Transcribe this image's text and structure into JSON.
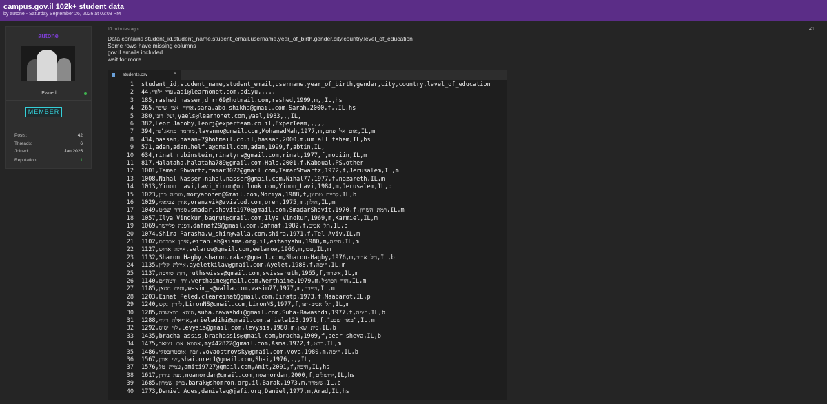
{
  "thread": {
    "title": "campus.gov.il 102k+ student data",
    "byline": "by autone - Saturday September 26, 2026 at 02:03 PM"
  },
  "author": {
    "username": "autone",
    "rank": "Pwned",
    "badge": "MEMBER",
    "stats": [
      {
        "label": "Posts:",
        "value": "42"
      },
      {
        "label": "Threads:",
        "value": "6"
      },
      {
        "label": "Joined:",
        "value": "Jan 2025"
      },
      {
        "label": "Reputation:",
        "value": "1"
      }
    ]
  },
  "post": {
    "time": "17 minutes ago",
    "number": "#1",
    "lines": [
      "Data contains student_id,student_name,student_email,username,year_of_birth,gender,city,country,level_of_education",
      "Some rows have missing columns",
      "gov.il emails included",
      "wait for more"
    ]
  },
  "editor": {
    "tab_label": "students.csv",
    "close_glyph": "×",
    "lines": [
      "student_id,student_name,student_email,username,year_of_birth,gender,city,country,level_of_education",
      "44,עדי ילודי,adi@learnonet.com,adiyu,,,,,",
      "185,rashed nasser,d_rn69@hotmail.com,rashed,1999,m,,IL,hs",
      "265,ארוח אבו שיכה,sara.abo.shikha@gmail.com,Sarah,2000,f,,IL,hs",
      "380,יעל רונן,yaels@learnonet.com,yael,1983,,,IL,",
      "382,Leor Jacoby,leorj@experteam.co.il,ExperTeam,,,,,",
      "394,מוחמד מחאג'נה,layanmo@gmail.com,MohamedMah,1977,m,אום אל פחם,IL,m",
      "434,hassan,hasan-7@hotmail.co.il,hassan,2000,m,um all fahem,IL,hs",
      "571,adan,adan.helf.a@gmail.com,adan,1999,f,abtin,IL,",
      "634,rinat rubinstein,rinatyrs@gmail.com,rinat,1977,f,modiin,IL,m",
      "817,Halataha,halataha789@gmail.com,Hala,2001,f,Kaboual,PS,other",
      "1001,Tamar Shwartz,tamar3022@gmail.com,TamarShwartz,1972,f,Jerusalem,IL,m",
      "1008,Nihal Nasser,nihal.nasser@gmail.com,Nihal77,1977,f,nazareth,IL,m",
      "1013,Yinon Lavi,Lavi_Yinon@outlook.com,Yinon_Lavi,1984,m,Jerusalem,IL,b",
      "1023,מוריה כהן,moryacohen@Gmail.com,Moriya,1988,f,קריית טבעון,IL,b",
      "1029,אורן צביאלי,orenzvik@zvialod.com,oren,1975,m,חולון,IL,m",
      "1049,סמדר שביט,smadar.shavit1970@gmail.com,SmadarShavit,1970,f,רמת השרון,IL,m",
      "1057,Ilya Vinokur,bagrut@gmail.com,Ilya_Vinokur,1969,m,Karmiel,IL,m",
      "1069,דפנה פליישר,dafnaf29@gmail.com,Dafnaf,1982,f,תל אביב,IL,b",
      "1074,Shira Parasha,w_shir@walla.com,shira,1971,f,Tel Aviv,IL,m",
      "1102,איתן אברהם,eitan.ab@sisma.org.il,eitanyahu,1980,m,חיפה,IL,m",
      "1127,אילה ארוש,eelarow@gmail.com,eelarow,1966,m,עכו,IL,m",
      "1132,Sharon Hagby,sharon.rakaz@gmail.com,Sharon-Hagby,1976,m,תל אביב,IL,b",
      "1135,איילת קליין,ayeletkilav@gmail.com,Ayelet,1988,f,חיפה,IL,m",
      "1137,רות סוויסה,ruthswissa@gmail.com,swissaruth,1965,f,אשדוד,IL,m",
      "1140,ורד ורטהיים,werthaime@gmail.com,Werthaime,1979,m,חוף הכרמל,IL,m",
      "1185,וסים חסאן,wasim_s@walla.com,wasim77,1977,m,טייבה,IL,m",
      "1203,Einat Peled,cleareinat@gmail.com,Einatp,1973,f,Maabarot,IL,p",
      "1240,לירון נקש,LironNS@gmail.com,LironNS,1977,f,תל אביב-יפו,IL,m",
      "1285,סוהא רוואשדה,suha.rawashdi@gmail.com,Suha-Rawashdi,1977,f,חיפה,IL,b",
      "1288,אריאלה דיחי,arieladihi@gmail.com,ariela123,1971,f,\"באר שבע\",IL,m",
      "1292,לוי יסיס,levysis@gmail.com,levysis,1980,m,בית שאן,IL,b",
      "1435,bracha assis,brachassis@gmail.com,bracha,1909,f,beer sheva,IL,b",
      "1475,אסמא אבו עמאר,my442822@gmail.com,Asma,1972,f,רהט,IL,m",
      "1486,וובה אוסטרובסקי,vovaostrovsky@gmail.com,vova,1980,m,חיפה,IL,b",
      "1567,שי אורן,shai.oren1@gmail.com,Shai,1976,,,,IL,",
      "1576,עמית טל,amiti9727@gmail.com,Amit,2001,f,חיפה,IL,hs",
      "1617,נעה נורדן,noanordan@gmail.com,noanordan,2000,f,ירושלים,IL,hs",
      "1685,ברק שמרון,barak@shomron.org.il,Barak,1973,m,שומרון,IL,b",
      "1773,Daniel Ages,danielaq@jafi.org,Daniel,1977,m,Arad,IL,hs"
    ]
  }
}
